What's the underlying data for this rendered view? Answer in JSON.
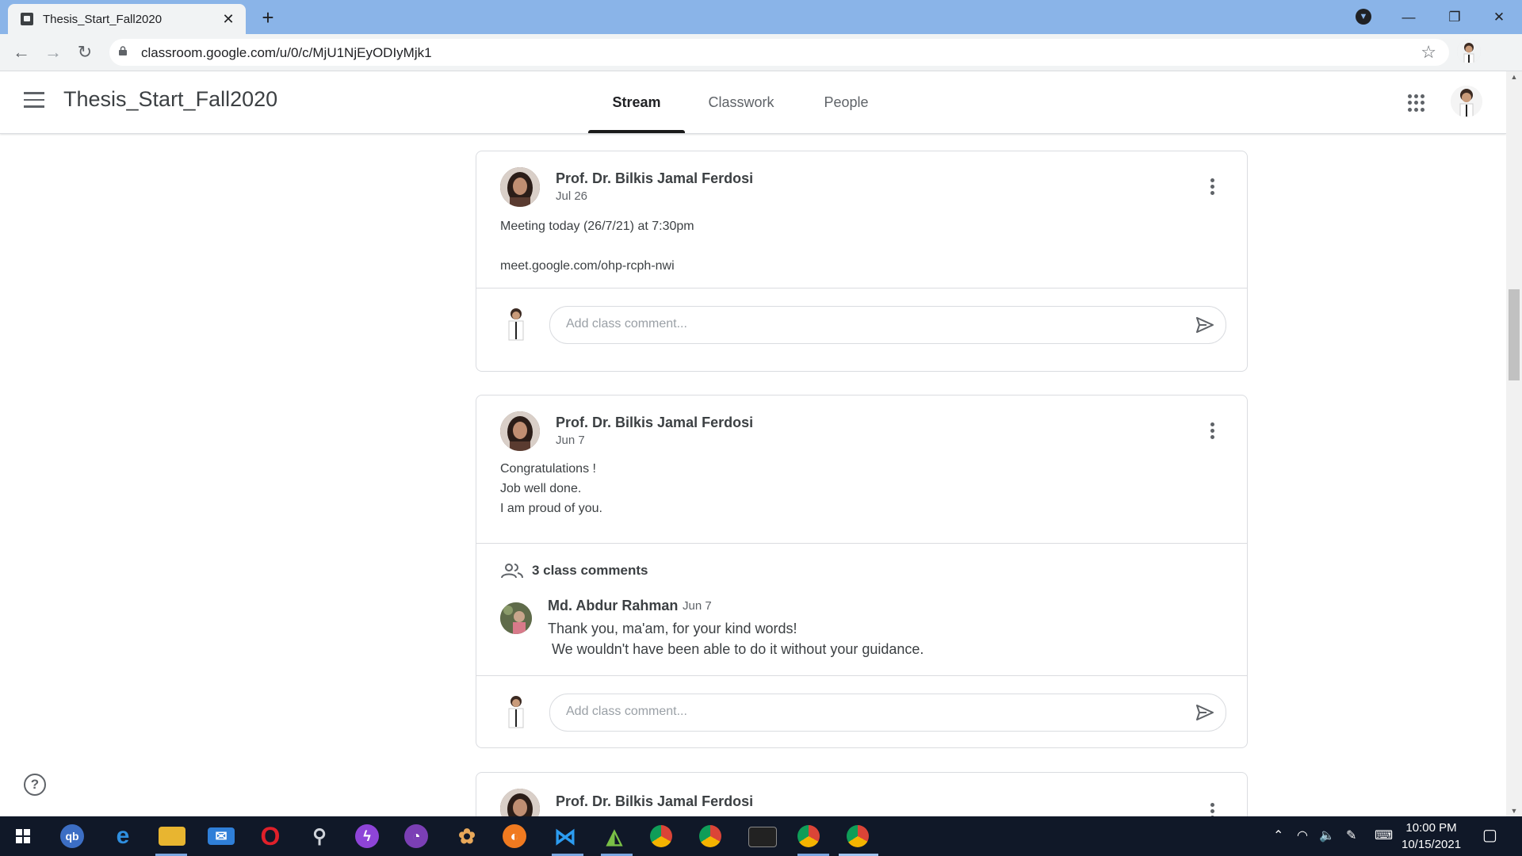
{
  "browser": {
    "tab_title": "Thesis_Start_Fall2020",
    "tab_close": "✕",
    "new_tab": "+",
    "url": "classroom.google.com/u/0/c/MjU1NjEyODIyMjk1",
    "window_controls": [
      "—",
      "❐",
      "✕"
    ]
  },
  "header": {
    "class_name": "Thesis_Start_Fall2020",
    "tabs": [
      {
        "label": "Stream",
        "active": true
      },
      {
        "label": "Classwork",
        "active": false
      },
      {
        "label": "People",
        "active": false
      }
    ]
  },
  "posts": [
    {
      "author": "Prof. Dr. Bilkis Jamal Ferdosi",
      "date": "Jul 26",
      "body_lines": [
        "Meeting today (26/7/21) at 7:30pm",
        "",
        "meet.google.com/ohp-rcph-nwi"
      ],
      "comment_placeholder": "Add class comment..."
    },
    {
      "author": "Prof. Dr. Bilkis Jamal Ferdosi",
      "date": "Jun 7",
      "body_lines": [
        "Congratulations !",
        "Job well done.",
        "I am proud of you."
      ],
      "class_comments_label": "3 class comments",
      "comment": {
        "author": "Md. Abdur Rahman",
        "date": "Jun 7",
        "text": "Thank you, ma'am, for your kind words!\n We wouldn't have been able to do it without your guidance."
      },
      "comment_placeholder": "Add class comment..."
    },
    {
      "author": "Prof. Dr. Bilkis Jamal Ferdosi",
      "date": ""
    }
  ],
  "help_label": "?",
  "taskbar": {
    "time": "10:00 PM",
    "date": "10/15/2021",
    "apps": [
      "windows-start",
      "qbittorrent",
      "edge",
      "file-explorer",
      "mail",
      "opera",
      "satellite",
      "messenger",
      "github-desktop",
      "paint",
      "firefox",
      "vscode",
      "android-studio",
      "chrome-profile-1",
      "chrome",
      "terminal",
      "chrome-ek",
      "chrome-active"
    ]
  }
}
